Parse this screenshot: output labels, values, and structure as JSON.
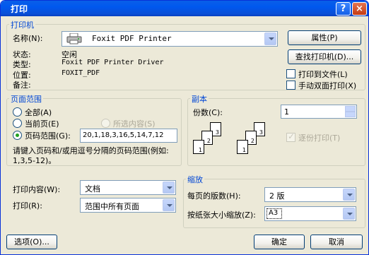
{
  "window": {
    "title": "打印",
    "help_glyph": "?",
    "close_glyph": "×"
  },
  "printer": {
    "group_title": "打印机",
    "name_label": "名称(N):",
    "name_value": "Foxit PDF Printer",
    "status_label": "状态:",
    "status_value": "空闲",
    "type_label": "类型:",
    "type_value": "Foxit PDF Printer Driver",
    "location_label": "位置:",
    "location_value": "FOXIT_PDF",
    "comment_label": "备注:",
    "comment_value": "",
    "properties_button": "属性(P)",
    "find_button": "查找打印机(D)...",
    "print_to_file_label": "打印到文件(L)",
    "manual_duplex_label": "手动双面打印(X)"
  },
  "page_range": {
    "group_title": "页面范围",
    "all_label": "全部(A)",
    "current_label": "当前页(E)",
    "selection_label": "所选内容(S)",
    "pages_label": "页码范围(G):",
    "pages_value": "20,1,18,3,16,5,14,7,12",
    "hint": "请键入页码和/或用逗号分隔的页码范围(例如: 1,3,5-12)。",
    "selected": "pages"
  },
  "copies": {
    "group_title": "副本",
    "count_label": "份数(C):",
    "count_value": "1",
    "collate_label": "逐份打印(T)",
    "stack_a": [
      "3",
      "2",
      "1"
    ],
    "stack_b": [
      "3",
      "2",
      "1"
    ]
  },
  "print_what": {
    "label": "打印内容(W):",
    "value": "文档"
  },
  "print_mode": {
    "label": "打印(R):",
    "value": "范围中所有页面"
  },
  "zoom": {
    "group_title": "缩放",
    "pages_per_sheet_label": "每页的版数(H):",
    "pages_per_sheet_value": "2 版",
    "scale_label": "按纸张大小缩放(Z):",
    "scale_value": "A3"
  },
  "footer": {
    "options_button": "选项(O)...",
    "ok_button": "确定",
    "cancel_button": "取消"
  }
}
